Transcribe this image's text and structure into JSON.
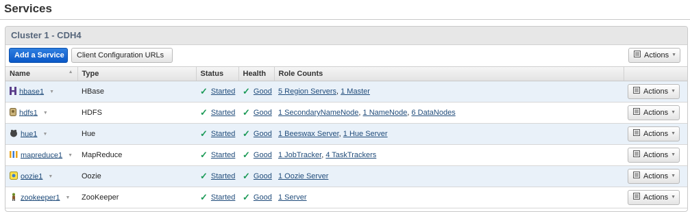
{
  "page": {
    "title": "Services"
  },
  "panel": {
    "title": "Cluster 1 - CDH4"
  },
  "toolbar": {
    "add_service_label": "Add a Service",
    "client_config_label": "Client Configuration URLs",
    "actions_label": "Actions"
  },
  "table": {
    "headers": [
      "Name",
      "Type",
      "Status",
      "Health",
      "Role Counts",
      ""
    ],
    "rows": [
      {
        "name": "hbase1",
        "type": "HBase",
        "status": "Started",
        "health": "Good",
        "roles": [
          "5 Region Servers",
          "1 Master"
        ],
        "icon": "hbase-icon",
        "actions": "Actions"
      },
      {
        "name": "hdfs1",
        "type": "HDFS",
        "status": "Started",
        "health": "Good",
        "roles": [
          "1 SecondaryNameNode",
          "1 NameNode",
          "6 DataNodes"
        ],
        "icon": "hdfs-icon",
        "actions": "Actions"
      },
      {
        "name": "hue1",
        "type": "Hue",
        "status": "Started",
        "health": "Good",
        "roles": [
          "1 Beeswax Server",
          "1 Hue Server"
        ],
        "icon": "hue-icon",
        "actions": "Actions"
      },
      {
        "name": "mapreduce1",
        "type": "MapReduce",
        "status": "Started",
        "health": "Good",
        "roles": [
          "1 JobTracker",
          "4 TaskTrackers"
        ],
        "icon": "mapreduce-icon",
        "actions": "Actions"
      },
      {
        "name": "oozie1",
        "type": "Oozie",
        "status": "Started",
        "health": "Good",
        "roles": [
          "1 Oozie Server"
        ],
        "icon": "oozie-icon",
        "actions": "Actions"
      },
      {
        "name": "zookeeper1",
        "type": "ZooKeeper",
        "status": "Started",
        "health": "Good",
        "roles": [
          "1 Server"
        ],
        "icon": "zookeeper-icon",
        "actions": "Actions"
      }
    ]
  },
  "colors": {
    "primary": "#0a58c8",
    "good": "#1b9a57",
    "link": "#1f4b7a",
    "row_alt": "#e9f1f9"
  }
}
